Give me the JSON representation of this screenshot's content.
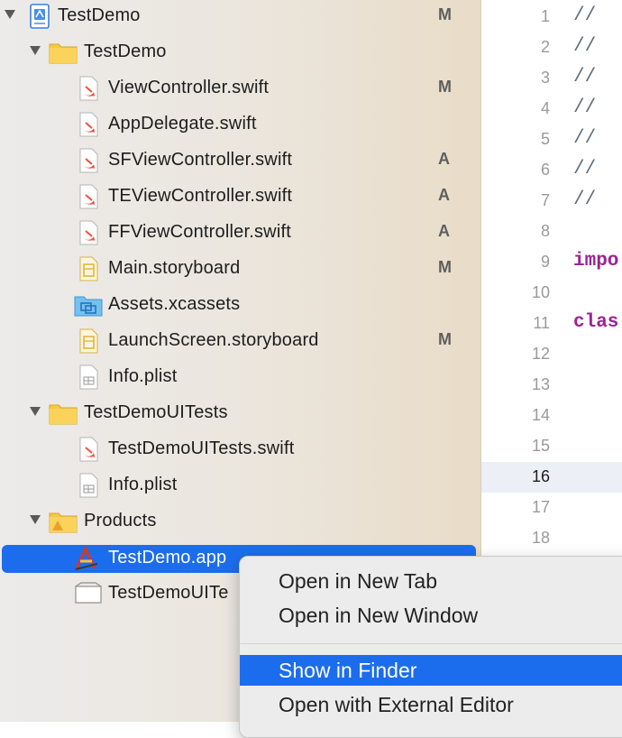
{
  "navigator": {
    "rows": [
      {
        "label": "TestDemo",
        "badge": "M"
      },
      {
        "label": "TestDemo",
        "badge": ""
      },
      {
        "label": "ViewController.swift",
        "badge": "M"
      },
      {
        "label": "AppDelegate.swift",
        "badge": ""
      },
      {
        "label": "SFViewController.swift",
        "badge": "A"
      },
      {
        "label": "TEViewController.swift",
        "badge": "A"
      },
      {
        "label": "FFViewController.swift",
        "badge": "A"
      },
      {
        "label": "Main.storyboard",
        "badge": "M"
      },
      {
        "label": "Assets.xcassets",
        "badge": ""
      },
      {
        "label": "LaunchScreen.storyboard",
        "badge": "M"
      },
      {
        "label": "Info.plist",
        "badge": ""
      },
      {
        "label": "TestDemoUITests",
        "badge": ""
      },
      {
        "label": "TestDemoUITests.swift",
        "badge": ""
      },
      {
        "label": "Info.plist",
        "badge": ""
      },
      {
        "label": "Products",
        "badge": ""
      },
      {
        "label": "TestDemo.app",
        "badge": ""
      },
      {
        "label": "TestDemoUITe",
        "badge": ""
      }
    ]
  },
  "editor": {
    "lines": [
      {
        "num": "1",
        "code": "//"
      },
      {
        "num": "2",
        "code": "//"
      },
      {
        "num": "3",
        "code": "//"
      },
      {
        "num": "4",
        "code": "//"
      },
      {
        "num": "5",
        "code": "//"
      },
      {
        "num": "6",
        "code": "//"
      },
      {
        "num": "7",
        "code": "//"
      },
      {
        "num": "8",
        "code": ""
      },
      {
        "num": "9",
        "code": "impo"
      },
      {
        "num": "10",
        "code": ""
      },
      {
        "num": "11",
        "code": "clas"
      },
      {
        "num": "12",
        "code": ""
      },
      {
        "num": "13",
        "code": ""
      },
      {
        "num": "14",
        "code": ""
      },
      {
        "num": "15",
        "code": ""
      },
      {
        "num": "16",
        "code": ""
      },
      {
        "num": "17",
        "code": ""
      },
      {
        "num": "18",
        "code": ""
      }
    ]
  },
  "context_menu": {
    "items": [
      {
        "label": "Open in New Tab"
      },
      {
        "label": "Open in New Window"
      },
      {
        "label": "Show in Finder"
      },
      {
        "label": "Open with External Editor"
      }
    ]
  },
  "colors": {
    "selection": "#1c6ded",
    "folder": "#f7c843",
    "swift": "#f05138",
    "keyword": "#9b2393"
  }
}
